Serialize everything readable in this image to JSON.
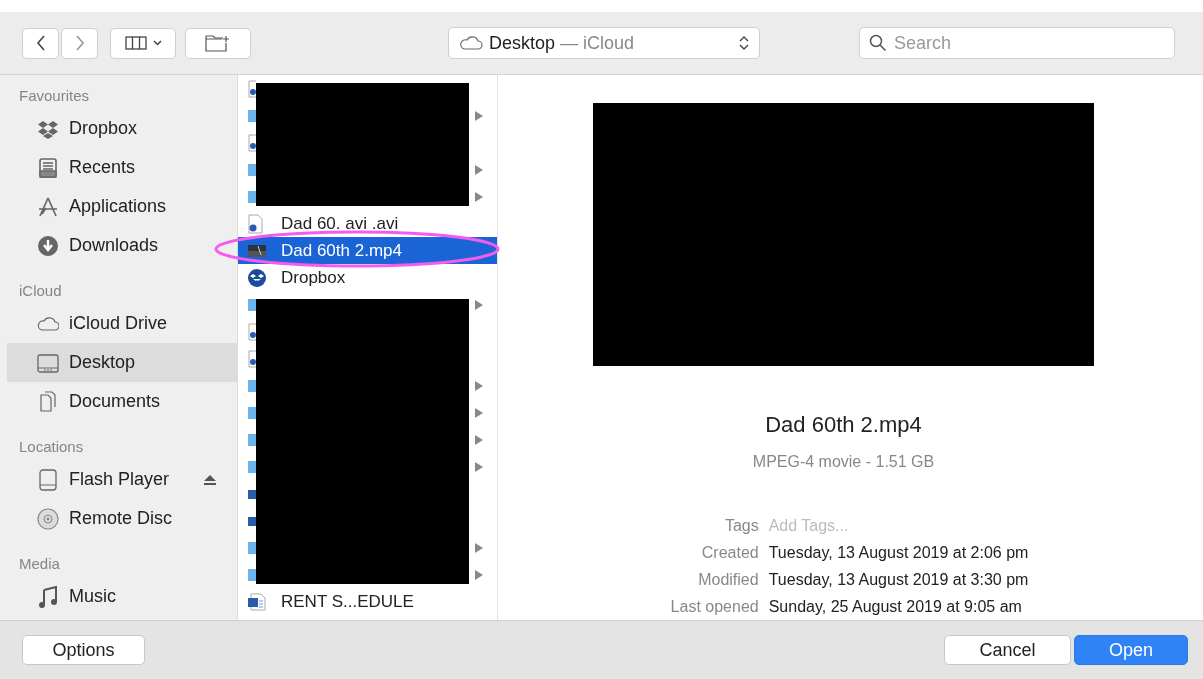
{
  "toolbar": {
    "location": {
      "folder": "Desktop",
      "separator": "—",
      "place": "iCloud"
    },
    "search": {
      "placeholder": "Search"
    }
  },
  "sidebar": {
    "sections": [
      {
        "title": "Favourites",
        "items": [
          {
            "kind": "dropbox",
            "label": "Dropbox",
            "selected": false,
            "ejectable": false
          },
          {
            "kind": "recents",
            "label": "Recents",
            "selected": false,
            "ejectable": false
          },
          {
            "kind": "applications",
            "label": "Applications",
            "selected": false,
            "ejectable": false
          },
          {
            "kind": "downloads",
            "label": "Downloads",
            "selected": false,
            "ejectable": false
          }
        ]
      },
      {
        "title": "iCloud",
        "items": [
          {
            "kind": "cloud",
            "label": "iCloud Drive",
            "selected": false,
            "ejectable": false
          },
          {
            "kind": "desktop",
            "label": "Desktop",
            "selected": true,
            "ejectable": false
          },
          {
            "kind": "documents",
            "label": "Documents",
            "selected": false,
            "ejectable": false
          }
        ]
      },
      {
        "title": "Locations",
        "items": [
          {
            "kind": "drive",
            "label": "Flash Player",
            "selected": false,
            "ejectable": true
          },
          {
            "kind": "disc",
            "label": "Remote Disc",
            "selected": false,
            "ejectable": false
          }
        ]
      },
      {
        "title": "Media",
        "items": [
          {
            "kind": "music",
            "label": "Music",
            "selected": false,
            "ejectable": false
          }
        ]
      }
    ]
  },
  "files": [
    {
      "kind": "redacted",
      "rows": [
        {
          "kind": "doc"
        },
        {
          "kind": "folder"
        },
        {
          "kind": "doc"
        },
        {
          "kind": "folder"
        },
        {
          "kind": "folder"
        }
      ]
    },
    {
      "kind": "doc",
      "name": "Dad 60. avi .avi",
      "selected": false
    },
    {
      "kind": "video",
      "name": "Dad 60th 2.mp4",
      "selected": true
    },
    {
      "kind": "dropbox",
      "name": "Dropbox",
      "selected": false
    },
    {
      "kind": "redacted",
      "rows": [
        {
          "kind": "folder"
        },
        {
          "kind": "doc"
        },
        {
          "kind": "doc"
        },
        {
          "kind": "folder"
        },
        {
          "kind": "folder"
        },
        {
          "kind": "folder"
        },
        {
          "kind": "folder"
        },
        {
          "kind": "word"
        },
        {
          "kind": "word"
        },
        {
          "kind": "folder"
        },
        {
          "kind": "folder"
        }
      ]
    },
    {
      "kind": "word",
      "name": "RENT S...EDULE",
      "selected": false
    }
  ],
  "preview": {
    "redacted": true,
    "name": "Dad 60th 2.mp4",
    "info": "MPEG-4 movie - 1.51 GB",
    "fields": [
      {
        "kind": "tags",
        "label": "Tags",
        "placeholder": "Add Tags..."
      },
      {
        "kind": "text",
        "label": "Created",
        "value": "Tuesday, 13 August 2019 at 2:06 pm"
      },
      {
        "kind": "text",
        "label": "Modified",
        "value": "Tuesday, 13 August 2019 at 3:30 pm"
      },
      {
        "kind": "text",
        "label": "Last opened",
        "value": "Sunday, 25 August 2019 at 9:05 am"
      }
    ]
  },
  "annotation": {
    "kind": "ellipse"
  },
  "buttons": {
    "left": [
      {
        "label": "Options",
        "default": false
      }
    ],
    "right": [
      {
        "label": "Cancel",
        "default": false
      },
      {
        "label": "Open",
        "default": true
      }
    ]
  }
}
